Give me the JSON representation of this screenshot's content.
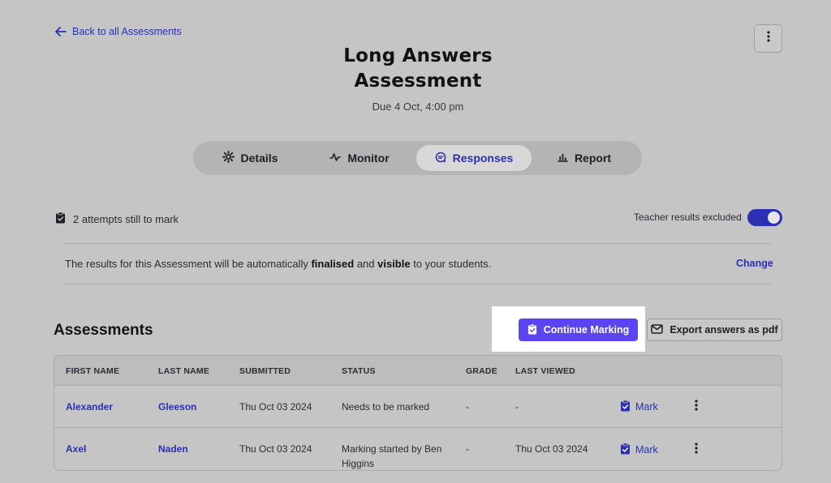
{
  "back_link": {
    "label": "Back to all Assessments"
  },
  "header": {
    "title_line1": "Long Answers",
    "title_line2": "Assessment",
    "due": "Due 4 Oct, 4:00 pm"
  },
  "tabs": [
    {
      "label": "Details",
      "icon": "gear-icon"
    },
    {
      "label": "Monitor",
      "icon": "pulse-icon"
    },
    {
      "label": "Responses",
      "icon": "chat-icon",
      "active": true
    },
    {
      "label": "Report",
      "icon": "bar-chart-icon"
    }
  ],
  "status": {
    "attempts": "2 attempts still to mark",
    "teacher_results_label": "Teacher results excluded",
    "teacher_results_on": true
  },
  "notice": {
    "prefix": "The results for this Assessment will be automatically ",
    "bold1": "finalised",
    "mid": " and ",
    "bold2": "visible",
    "suffix": " to your students.",
    "change_label": "Change"
  },
  "section": {
    "title": "Assessments",
    "continue_label": "Continue Marking",
    "export_label": "Export answers as pdf"
  },
  "table": {
    "columns": [
      "FIRST NAME",
      "LAST NAME",
      "SUBMITTED",
      "STATUS",
      "GRADE",
      "LAST VIEWED"
    ],
    "rows": [
      {
        "first": "Alexander",
        "last": "Gleeson",
        "submitted": "Thu Oct 03 2024",
        "status_line1": "Needs to be marked",
        "status_line2": "",
        "grade": "-",
        "last_viewed": "-",
        "action": "Mark"
      },
      {
        "first": "Axel",
        "last": "Naden",
        "submitted": "Thu Oct 03 2024",
        "status_line1": "Marking started by Ben",
        "status_line2": "Higgins",
        "grade": "-",
        "last_viewed": "Thu Oct 03 2024",
        "action": "Mark"
      }
    ]
  },
  "colors": {
    "accent": "#2b2fb4",
    "primary_button": "#5b45f2",
    "background": "#c5c5c5"
  }
}
